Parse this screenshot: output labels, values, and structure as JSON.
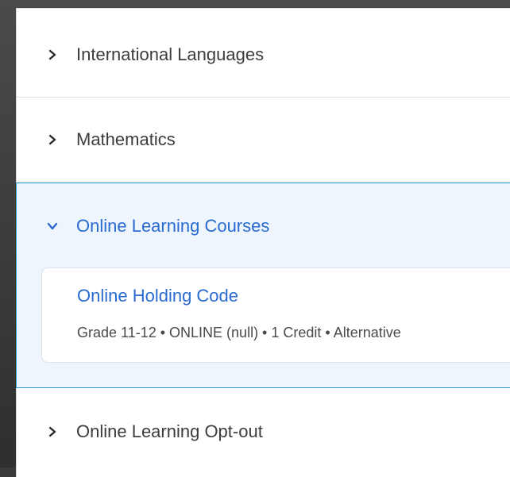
{
  "categories": [
    {
      "label": "International Languages",
      "expanded": false
    },
    {
      "label": "Mathematics",
      "expanded": false
    },
    {
      "label": "Online Learning Courses",
      "expanded": true
    },
    {
      "label": "Online Learning Opt-out",
      "expanded": false
    }
  ],
  "expanded_course": {
    "title": "Online Holding Code",
    "meta": "Grade 11-12 • ONLINE (null) • 1 Credit • Alternative"
  },
  "colors": {
    "link_blue": "#2a6bd1",
    "expanded_bg": "#eef5fc",
    "expanded_border": "#2f9fd3",
    "text_dark": "#3c3c3c"
  },
  "icons": {
    "collapsed": "chevron-right-icon",
    "expanded": "chevron-down-icon"
  }
}
